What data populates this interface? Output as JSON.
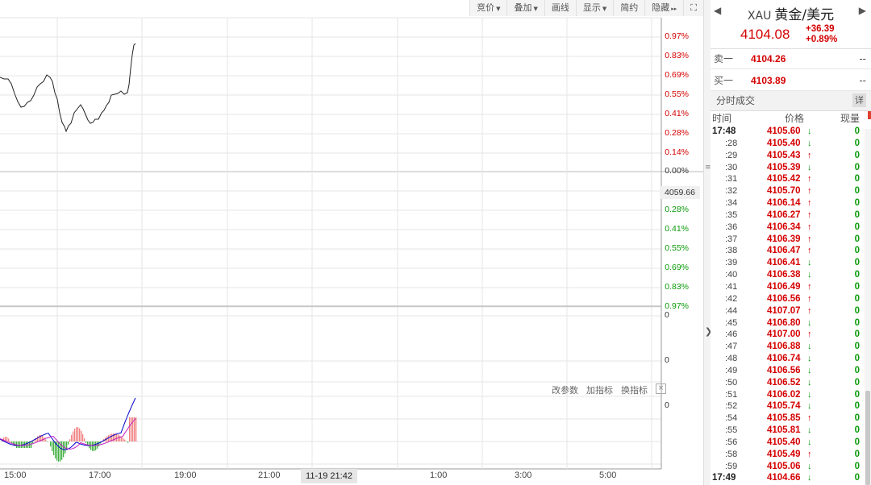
{
  "toolbar": {
    "items": [
      {
        "label": "竞价",
        "dropdown": true
      },
      {
        "label": "叠加",
        "dropdown": true
      },
      {
        "label": "画线",
        "dropdown": false
      },
      {
        "label": "显示",
        "dropdown": true
      },
      {
        "label": "简约",
        "dropdown": false
      },
      {
        "label": "隐藏",
        "dropdown": false,
        "suffix": "▸▸"
      }
    ],
    "fullscreen_icon": "fullscreen-icon"
  },
  "price_axis": {
    "up": [
      "0.97%",
      "0.83%",
      "0.69%",
      "0.55%",
      "0.41%",
      "0.28%",
      "0.14%"
    ],
    "zero": "0.00%",
    "down": [
      "0.28%",
      "0.41%",
      "0.55%",
      "0.69%",
      "0.83%",
      "0.97%"
    ],
    "base_value": "4059.66"
  },
  "volume_axis": [
    "0",
    "0",
    "0"
  ],
  "indicator_toolbar": {
    "modify": "改参数",
    "add": "加指标",
    "change": "换指标",
    "close": "×"
  },
  "time_axis": {
    "labels": [
      "15:00",
      "17:00",
      "19:00",
      "21:00",
      "1:00",
      "3:00",
      "5:00"
    ],
    "cursor": "11-19 21:42"
  },
  "quote": {
    "code": "XAU",
    "name": "黄金/美元",
    "price": "4104.08",
    "change": "+36.39",
    "change_pct": "+0.89%"
  },
  "order_book": [
    {
      "label": "卖一",
      "price": "4104.26",
      "volume": "--"
    },
    {
      "label": "买一",
      "price": "4103.89",
      "volume": "--"
    }
  ],
  "ticks_section": {
    "title": "分时成交",
    "detail": "详",
    "headers": {
      "time": "时间",
      "price": "价格",
      "volume": "现量"
    },
    "rows": [
      {
        "time": "17:48",
        "price": "4105.60",
        "dir": "down",
        "vol": "0"
      },
      {
        "time": ":28",
        "price": "4105.40",
        "dir": "down",
        "vol": "0"
      },
      {
        "time": ":29",
        "price": "4105.43",
        "dir": "up",
        "vol": "0"
      },
      {
        "time": ":30",
        "price": "4105.39",
        "dir": "down",
        "vol": "0"
      },
      {
        "time": ":31",
        "price": "4105.42",
        "dir": "up",
        "vol": "0"
      },
      {
        "time": ":32",
        "price": "4105.70",
        "dir": "up",
        "vol": "0"
      },
      {
        "time": ":34",
        "price": "4106.14",
        "dir": "up",
        "vol": "0"
      },
      {
        "time": ":35",
        "price": "4106.27",
        "dir": "up",
        "vol": "0"
      },
      {
        "time": ":36",
        "price": "4106.34",
        "dir": "up",
        "vol": "0"
      },
      {
        "time": ":37",
        "price": "4106.39",
        "dir": "up",
        "vol": "0"
      },
      {
        "time": ":38",
        "price": "4106.47",
        "dir": "up",
        "vol": "0"
      },
      {
        "time": ":39",
        "price": "4106.41",
        "dir": "down",
        "vol": "0"
      },
      {
        "time": ":40",
        "price": "4106.38",
        "dir": "down",
        "vol": "0"
      },
      {
        "time": ":41",
        "price": "4106.49",
        "dir": "up",
        "vol": "0"
      },
      {
        "time": ":42",
        "price": "4106.56",
        "dir": "up",
        "vol": "0"
      },
      {
        "time": ":44",
        "price": "4107.07",
        "dir": "up",
        "vol": "0"
      },
      {
        "time": ":45",
        "price": "4106.80",
        "dir": "down",
        "vol": "0"
      },
      {
        "time": ":46",
        "price": "4107.00",
        "dir": "up",
        "vol": "0"
      },
      {
        "time": ":47",
        "price": "4106.88",
        "dir": "down",
        "vol": "0"
      },
      {
        "time": ":48",
        "price": "4106.74",
        "dir": "down",
        "vol": "0"
      },
      {
        "time": ":49",
        "price": "4106.56",
        "dir": "down",
        "vol": "0"
      },
      {
        "time": ":50",
        "price": "4106.52",
        "dir": "down",
        "vol": "0"
      },
      {
        "time": ":51",
        "price": "4106.02",
        "dir": "down",
        "vol": "0"
      },
      {
        "time": ":52",
        "price": "4105.74",
        "dir": "down",
        "vol": "0"
      },
      {
        "time": ":54",
        "price": "4105.85",
        "dir": "up",
        "vol": "0"
      },
      {
        "time": ":55",
        "price": "4105.81",
        "dir": "down",
        "vol": "0"
      },
      {
        "time": ":56",
        "price": "4105.40",
        "dir": "down",
        "vol": "0"
      },
      {
        "time": ":58",
        "price": "4105.49",
        "dir": "up",
        "vol": "0"
      },
      {
        "time": ":59",
        "price": "4105.06",
        "dir": "down",
        "vol": "0"
      },
      {
        "time": "17:49",
        "price": "4104.66",
        "dir": "down",
        "vol": "0"
      }
    ]
  },
  "colors": {
    "up": "#d40000",
    "down": "#0a9a0a",
    "grid": "#e6e6e6"
  }
}
